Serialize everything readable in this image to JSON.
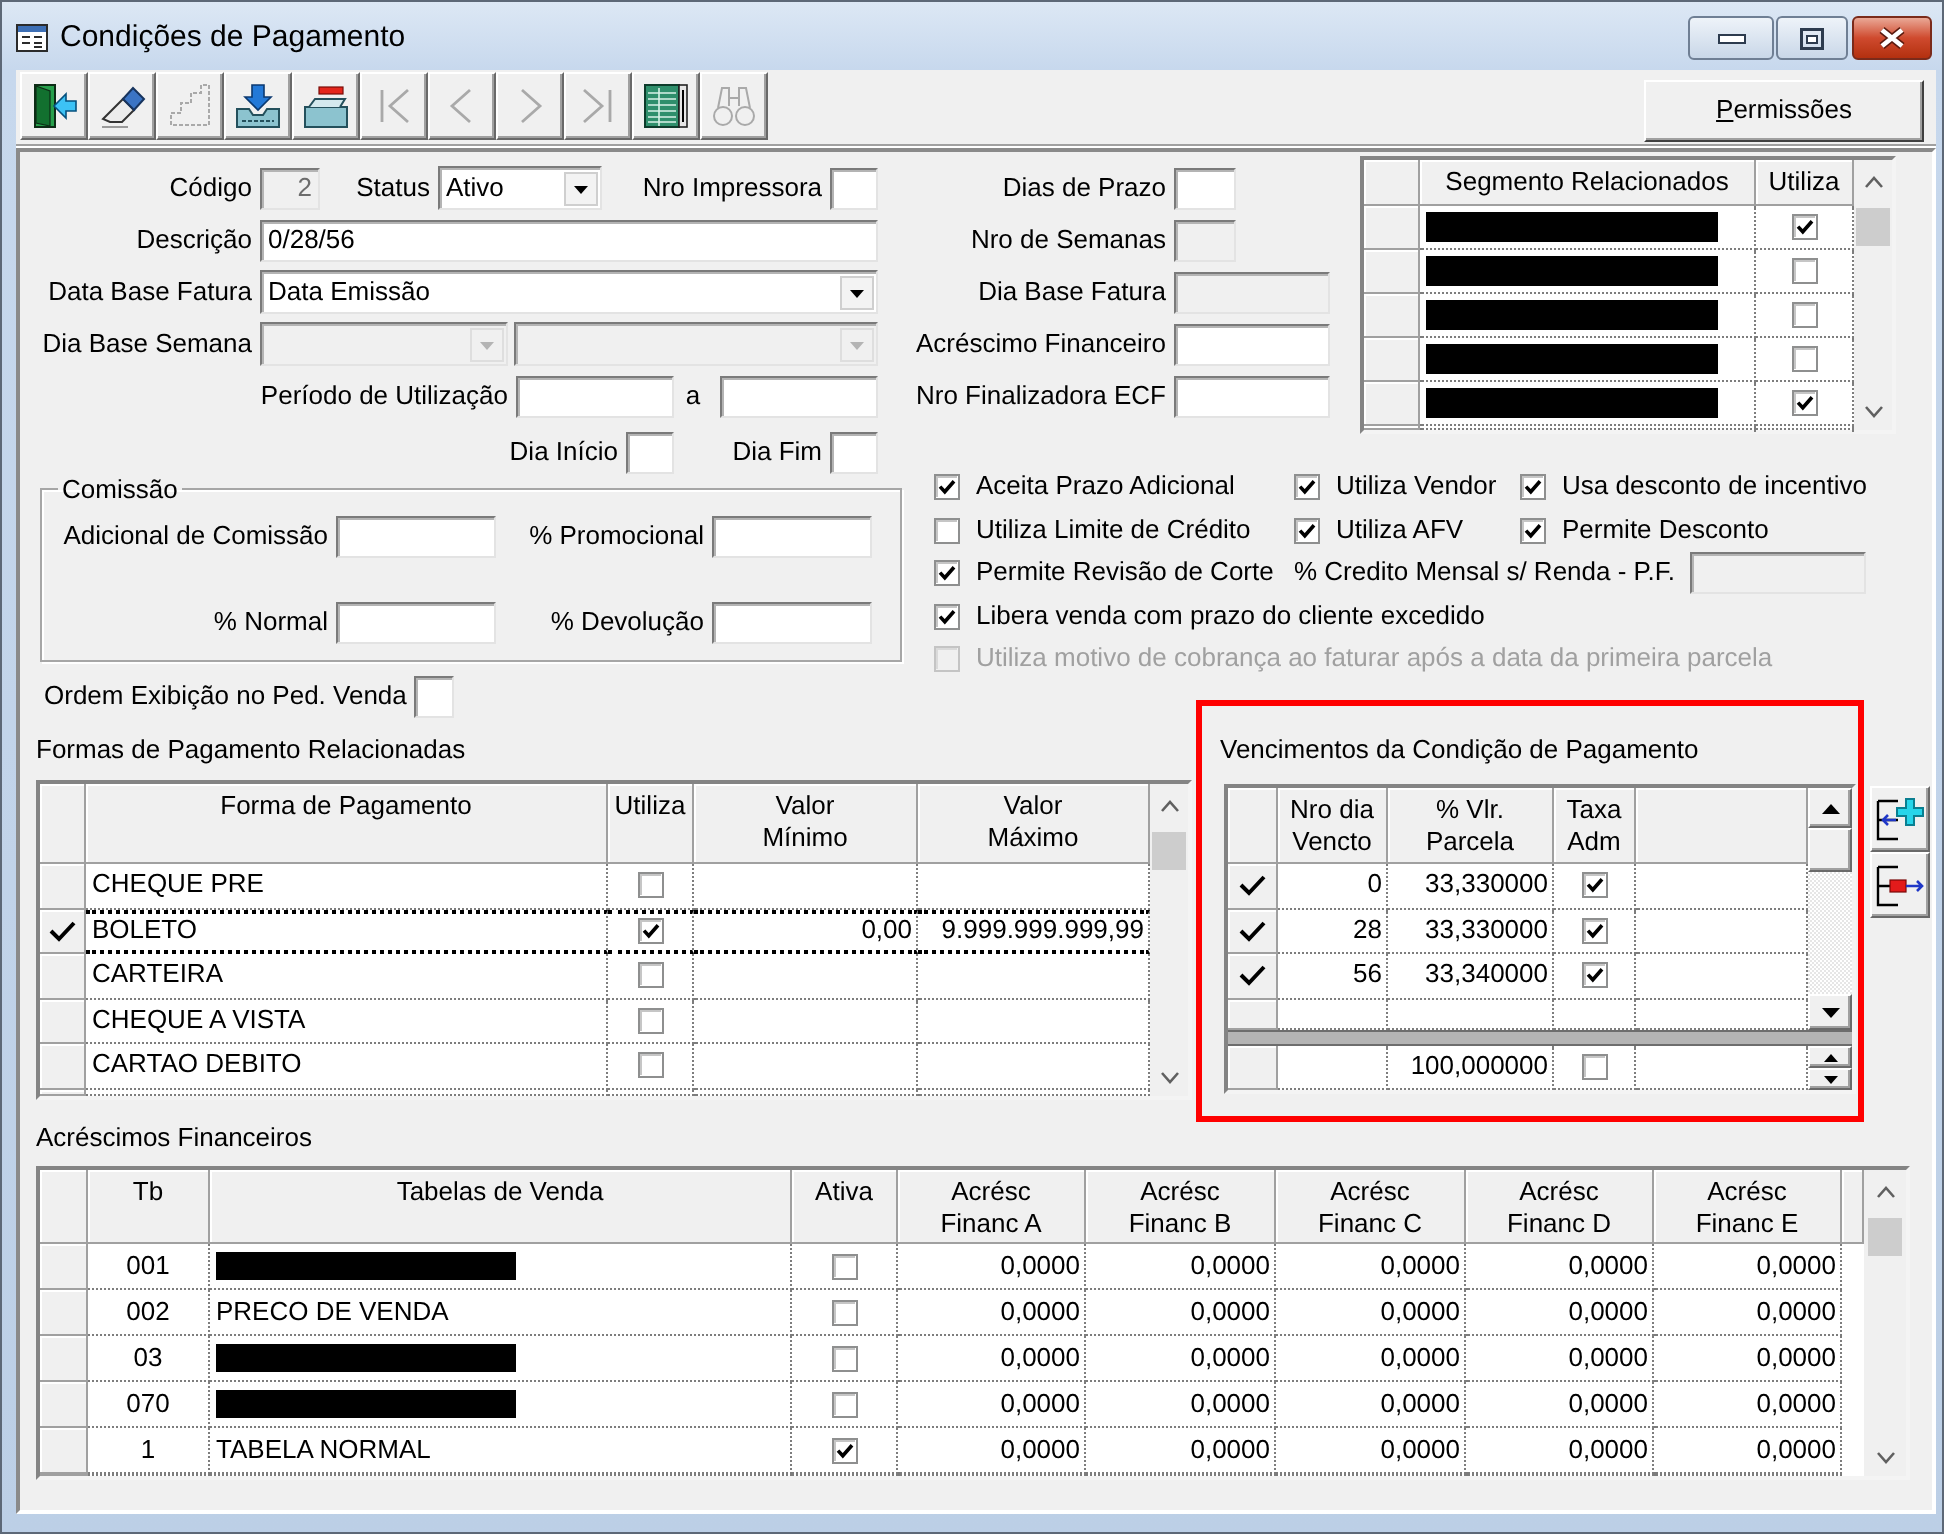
{
  "window": {
    "title": "Condições de Pagamento"
  },
  "toolbar": [
    {
      "kind": "exit",
      "disabled": false
    },
    {
      "kind": "eraser",
      "disabled": false
    },
    {
      "kind": "steps",
      "disabled": true
    },
    {
      "kind": "tray-download",
      "disabled": false
    },
    {
      "kind": "tray-remove",
      "disabled": false
    },
    {
      "kind": "first",
      "disabled": true
    },
    {
      "kind": "previous",
      "disabled": true
    },
    {
      "kind": "next",
      "disabled": true
    },
    {
      "kind": "last",
      "disabled": true
    },
    {
      "kind": "grid",
      "disabled": false
    },
    {
      "kind": "binoculars",
      "disabled": true
    }
  ],
  "permissions_button": {
    "label": "Permissões",
    "mnemonic_underlined": true
  },
  "fields": {
    "codigo": {
      "label": "Código",
      "value": "2",
      "disabled": true
    },
    "status": {
      "label": "Status",
      "value": "Ativo",
      "disabled": false
    },
    "nro_impressora": {
      "label": "Nro Impressora",
      "disabled": false
    },
    "descricao": {
      "label": "Descrição",
      "value": "0/28/56",
      "disabled": false
    },
    "data_base_fatura": {
      "label": "Data Base Fatura",
      "value": "Data Emissão",
      "disabled": false
    },
    "dia_base_semana": {
      "label": "Dia Base Semana",
      "disabled": true
    },
    "periodo_de_utilizacao": {
      "label": "Período de Utilização",
      "separator": "a",
      "disabled": false
    },
    "dia_inicio": {
      "label": "Dia Início",
      "disabled": false
    },
    "dia_fim": {
      "label": "Dia Fim",
      "disabled": false
    },
    "dias_de_prazo": {
      "label": "Dias de Prazo",
      "disabled": false
    },
    "nro_de_semanas": {
      "label": "Nro de Semanas",
      "disabled": true
    },
    "dia_base_fatura": {
      "label": "Dia Base Fatura",
      "disabled": true
    },
    "acrescimo_financeiro": {
      "label": "Acréscimo Financeiro",
      "disabled": false
    },
    "nro_finalizadora_ecf": {
      "label": "Nro Finalizadora ECF",
      "disabled": false
    }
  },
  "segments": {
    "columns": [
      "Segmento Relacionados",
      "Utiliza"
    ],
    "rows": [
      {
        "redacted": true,
        "utiliza": true
      },
      {
        "redacted": true,
        "utiliza": false
      },
      {
        "redacted": true,
        "utiliza": false
      },
      {
        "redacted": true,
        "utiliza": false
      },
      {
        "redacted": true,
        "utiliza": true
      }
    ]
  },
  "comissao": {
    "title": "Comissão",
    "fields": [
      {
        "label": "Adicional de Comissão",
        "disabled": false
      },
      {
        "label": "% Promocional",
        "disabled": false
      },
      {
        "label": "% Normal",
        "disabled": false
      },
      {
        "label": "% Devolução",
        "disabled": false
      }
    ]
  },
  "ordem_exibicao": {
    "label": "Ordem Exibição no Ped. Venda",
    "disabled": false
  },
  "options": {
    "rows": [
      {
        "items": [
          {
            "kind": "checkbox",
            "label": "Aceita Prazo Adicional",
            "checked": true,
            "disabled": false
          },
          {
            "kind": "checkbox",
            "label": "Utiliza Vendor",
            "checked": true,
            "disabled": false
          },
          {
            "kind": "checkbox",
            "label": "Usa desconto de incentivo",
            "checked": true,
            "disabled": false
          }
        ]
      },
      {
        "items": [
          {
            "kind": "checkbox",
            "label": "Utiliza Limite de Crédito",
            "checked": false,
            "disabled": false
          },
          {
            "kind": "checkbox",
            "label": "Utiliza AFV",
            "checked": true,
            "disabled": false
          },
          {
            "kind": "checkbox",
            "label": "Permite Desconto",
            "checked": true,
            "disabled": false
          }
        ]
      },
      {
        "items": [
          {
            "kind": "checkbox",
            "label": "Permite Revisão de Corte",
            "checked": true,
            "disabled": false
          },
          {
            "kind": "field",
            "label": "% Credito Mensal s/ Renda - P.F.",
            "disabled": true
          }
        ]
      },
      {
        "items": [
          {
            "kind": "checkbox",
            "label": "Libera venda com prazo do cliente excedido",
            "checked": true,
            "disabled": false
          }
        ]
      },
      {
        "items": [
          {
            "kind": "checkbox",
            "label": "Utiliza motivo de cobrança ao faturar após a data da primeira parcela",
            "checked": false,
            "disabled": true
          }
        ]
      }
    ]
  },
  "formas": {
    "title": "Formas de Pagamento Relacionadas",
    "columns": [
      "Forma de Pagamento",
      "Utiliza",
      "Valor\nMínimo",
      "Valor\nMáximo"
    ],
    "rows": [
      {
        "forma": "CHEQUE PRE",
        "utiliza": false,
        "selected": false
      },
      {
        "forma": "BOLETO",
        "utiliza": true,
        "valor_minimo": "0,00",
        "valor_maximo": "9.999.999.999,99",
        "selected": true
      },
      {
        "forma": "CARTEIRA",
        "utiliza": false,
        "selected": false
      },
      {
        "forma": "CHEQUE A VISTA",
        "utiliza": false,
        "selected": false
      },
      {
        "forma": "CARTAO DEBITO",
        "utiliza": false,
        "selected": false
      }
    ]
  },
  "vencimentos": {
    "title": "Vencimentos da Condição de Pagamento",
    "highlighted": true,
    "columns": [
      "Nro dia\nVencto",
      "% Vlr.\nParcela",
      "Taxa\nAdm"
    ],
    "rows": [
      {
        "nro_dia": "0",
        "percentual": "33,330000",
        "taxa_adm": true,
        "selected": true
      },
      {
        "nro_dia": "28",
        "percentual": "33,330000",
        "taxa_adm": true,
        "selected": true
      },
      {
        "nro_dia": "56",
        "percentual": "33,340000",
        "taxa_adm": true,
        "selected": true
      }
    ],
    "total": {
      "percentual": "100,000000",
      "taxa_adm": false
    },
    "side_buttons": [
      {
        "kind": "add-row"
      },
      {
        "kind": "remove-row"
      }
    ]
  },
  "acrescimos": {
    "title": "Acréscimos Financeiros",
    "columns": [
      "Tb",
      "Tabelas de Venda",
      "Ativa",
      "Acrésc\nFinanc A",
      "Acrésc\nFinanc B",
      "Acrésc\nFinanc C",
      "Acrésc\nFinanc D",
      "Acrésc\nFinanc E"
    ],
    "rows": [
      {
        "tb": "001",
        "redacted": true,
        "ativa": false,
        "valores": [
          "0,0000",
          "0,0000",
          "0,0000",
          "0,0000",
          "0,0000"
        ]
      },
      {
        "tb": "002",
        "redacted": false,
        "tabela": "PRECO DE VENDA",
        "ativa": false,
        "valores": [
          "0,0000",
          "0,0000",
          "0,0000",
          "0,0000",
          "0,0000"
        ]
      },
      {
        "tb": "03",
        "redacted": true,
        "ativa": false,
        "valores": [
          "0,0000",
          "0,0000",
          "0,0000",
          "0,0000",
          "0,0000"
        ]
      },
      {
        "tb": "070",
        "redacted": true,
        "ativa": false,
        "valores": [
          "0,0000",
          "0,0000",
          "0,0000",
          "0,0000",
          "0,0000"
        ]
      },
      {
        "tb": "1",
        "redacted": false,
        "tabela": "TABELA NORMAL",
        "ativa": true,
        "valores": [
          "0,0000",
          "0,0000",
          "0,0000",
          "0,0000",
          "0,0000"
        ]
      }
    ]
  }
}
